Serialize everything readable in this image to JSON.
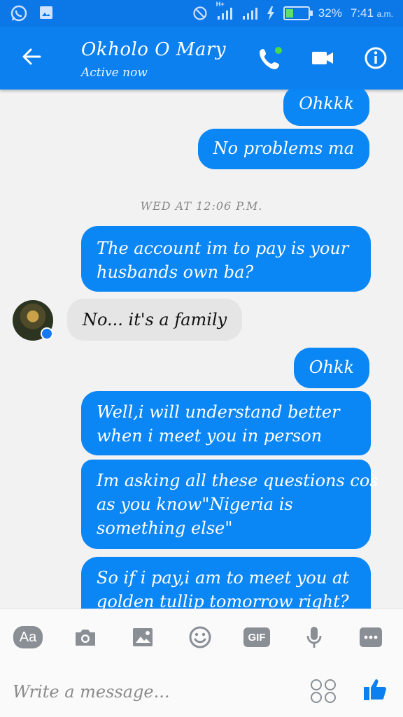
{
  "status_bar": {
    "battery_percent": "32%",
    "time": "7:41",
    "ampm": "a.m.",
    "network": "H+",
    "battery_level": 0.32
  },
  "header": {
    "contact_name": "Okholo O Mary",
    "status": "Active now"
  },
  "conversation": {
    "messages_top": [
      {
        "side": "out",
        "text": "Ohkkk"
      },
      {
        "side": "out",
        "text": "No problems ma"
      }
    ],
    "timestamp": "WED AT 12:06 P.M.",
    "msg_account": [
      "The account im to pay is your",
      "husbands own ba?"
    ],
    "reply_in": "No... it's a family",
    "msg_ohkk": "Ohkk",
    "msg_understand": [
      "Well,i will understand better",
      "when i meet you in person"
    ],
    "msg_questions": [
      "Im asking all these questions cos",
      "as you know\"Nigeria is",
      "something else\""
    ],
    "msg_pay": [
      "So if i pay,i am to meet you at",
      "golden tullip tomorrow right?"
    ]
  },
  "composer": {
    "aa_label": "Aa",
    "gif_label": "GIF",
    "placeholder": "Write a message..."
  },
  "colors": {
    "bar": "#0d80ef",
    "bubble_out": "#0b86f5",
    "bubble_in": "#e5e5e5"
  }
}
